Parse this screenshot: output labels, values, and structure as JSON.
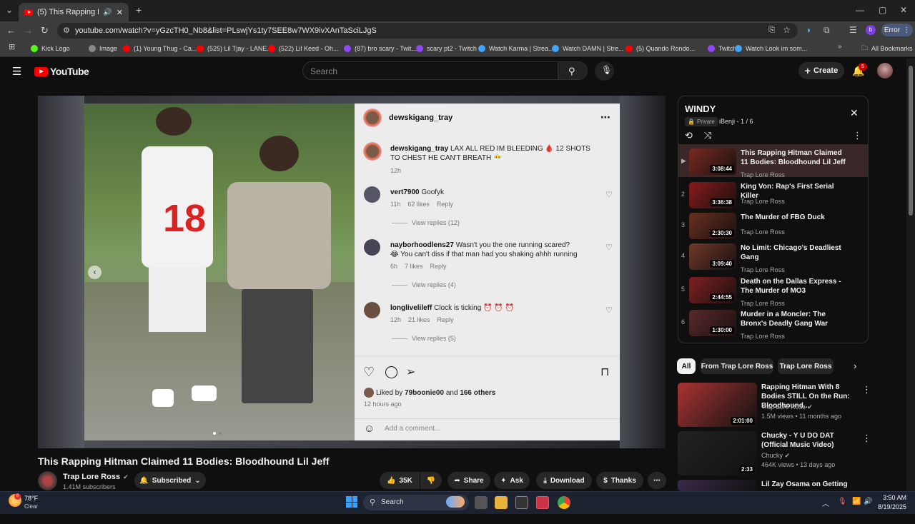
{
  "browser": {
    "tab_title": "(5) This Rapping Hitman Cl...",
    "url": "youtube.com/watch?v=yGzcTH0_Nb8&list=PLswjYs1ty7SEE8w7WX9ivXAnTaSciLJgS",
    "profile_badge": "Error",
    "bookmarks": [
      {
        "label": "Kick Logo",
        "color": "#53fc18"
      },
      {
        "label": "Image",
        "color": "#888"
      },
      {
        "label": "(1) Young Thug - Ca...",
        "color": "#ff0000"
      },
      {
        "label": "(525) Lil Tjay - LANE...",
        "color": "#ff0000"
      },
      {
        "label": "(522) Lil Keed - Oh...",
        "color": "#ff0000"
      },
      {
        "label": "(87) bro scary - Twit...",
        "color": "#9146ff"
      },
      {
        "label": "scary pt2 - Twitch",
        "color": "#9146ff"
      },
      {
        "label": "Watch Karma | Strea...",
        "color": "#3ea6ff"
      },
      {
        "label": "Watch DAMN | Stre...",
        "color": "#3ea6ff"
      },
      {
        "label": "(5) Quando Rondo...",
        "color": "#ff0000"
      },
      {
        "label": "Twitch",
        "color": "#9146ff"
      },
      {
        "label": "Watch Look im som...",
        "color": "#3ea6ff"
      }
    ],
    "all_bookmarks": "All Bookmarks"
  },
  "youtube": {
    "logo": "YouTube",
    "search_placeholder": "Search",
    "create_label": "Create",
    "notif_count": "5"
  },
  "instagram": {
    "username": "dewskigang_tray",
    "caption_user": "dewskigang_tray",
    "caption_text": "LAX ALL RED IM BLEEDING 🩸 12 SHOTS TO CHEST HE CAN'T BREATH 😶‍🌫",
    "caption_time": "12h",
    "comments": [
      {
        "user": "vert7900",
        "text": "Goofyk",
        "time": "11h",
        "likes": "62 likes",
        "reply": "Reply",
        "view": "View replies (12)"
      },
      {
        "user": "nayborhoodlens27",
        "text": "Wasn't you the one running scared? 😂 You can't diss if that man had you shaking ahhh running",
        "time": "6h",
        "likes": "7 likes",
        "reply": "Reply",
        "view": "View replies (4)"
      },
      {
        "user": "longlivelileff",
        "text": "Clock is ticking ⏰ ⏰ ⏰",
        "time": "12h",
        "likes": "21 likes",
        "reply": "Reply",
        "view": "View replies (5)"
      }
    ],
    "liked_by_prefix": "Liked by",
    "liked_by_user": "79boonie00",
    "liked_by_and": "and",
    "liked_by_others": "166 others",
    "post_time": "12 hours ago",
    "add_comment": "Add a comment..."
  },
  "video": {
    "title": "This Rapping Hitman Claimed 11 Bodies: Bloodhound Lil Jeff",
    "channel": "Trap Lore Ross",
    "subscribers": "1.41M subscribers",
    "subscribed_label": "Subscribed",
    "likes": "35K",
    "share": "Share",
    "ask": "Ask",
    "download": "Download",
    "thanks": "Thanks"
  },
  "playlist": {
    "title": "WINDY",
    "privacy": "Private",
    "owner": "iBenji",
    "position": "1 / 6",
    "items": [
      {
        "idx": "▶",
        "title": "This Rapping Hitman Claimed 11 Bodies: Bloodhound Lil Jeff",
        "channel": "Trap Lore Ross",
        "duration": "3:08:44",
        "color": "#7a2a20"
      },
      {
        "idx": "2",
        "title": "King Von: Rap's First Serial Killer",
        "channel": "Trap Lore Ross",
        "duration": "3:36:38",
        "color": "#8a1a1a"
      },
      {
        "idx": "3",
        "title": "The Murder of FBG Duck",
        "channel": "Trap Lore Ross",
        "duration": "2:30:30",
        "color": "#6a3020"
      },
      {
        "idx": "4",
        "title": "No Limit: Chicago's Deadliest Gang",
        "channel": "Trap Lore Ross",
        "duration": "3:09:40",
        "color": "#703828"
      },
      {
        "idx": "5",
        "title": "Death on the Dallas Express - The Murder of MO3",
        "channel": "Trap Lore Ross",
        "duration": "2:44:55",
        "color": "#802020"
      },
      {
        "idx": "6",
        "title": "Murder in a Moncler: The Bronx's Deadly Gang War",
        "channel": "Trap Lore Ross",
        "duration": "1:30:00",
        "color": "#5a2a2a"
      }
    ]
  },
  "chips": [
    "All",
    "From Trap Lore Ross",
    "Trap Lore Ross"
  ],
  "recommendations": [
    {
      "title": "Rapping Hitman With 8 Bodies STILL On the Run: Bloodhound...",
      "channel": "Trap Lore Ross",
      "meta": "1.5M views • 11 months ago",
      "duration": "2:01:00",
      "color": "#a33"
    },
    {
      "title": "Chucky - Y U DO DAT (Official Music Video)",
      "channel": "Chucky",
      "meta": "464K views • 13 days ago",
      "duration": "2:33",
      "color": "#222"
    },
    {
      "title": "Lil Zay Osama on Getting",
      "channel": "",
      "meta": "",
      "duration": "",
      "color": "#3a2a4a"
    }
  ],
  "taskbar": {
    "temp": "78°F",
    "weather": "Clear",
    "search": "Search",
    "time": "3:50 AM",
    "date": "8/19/2025"
  }
}
